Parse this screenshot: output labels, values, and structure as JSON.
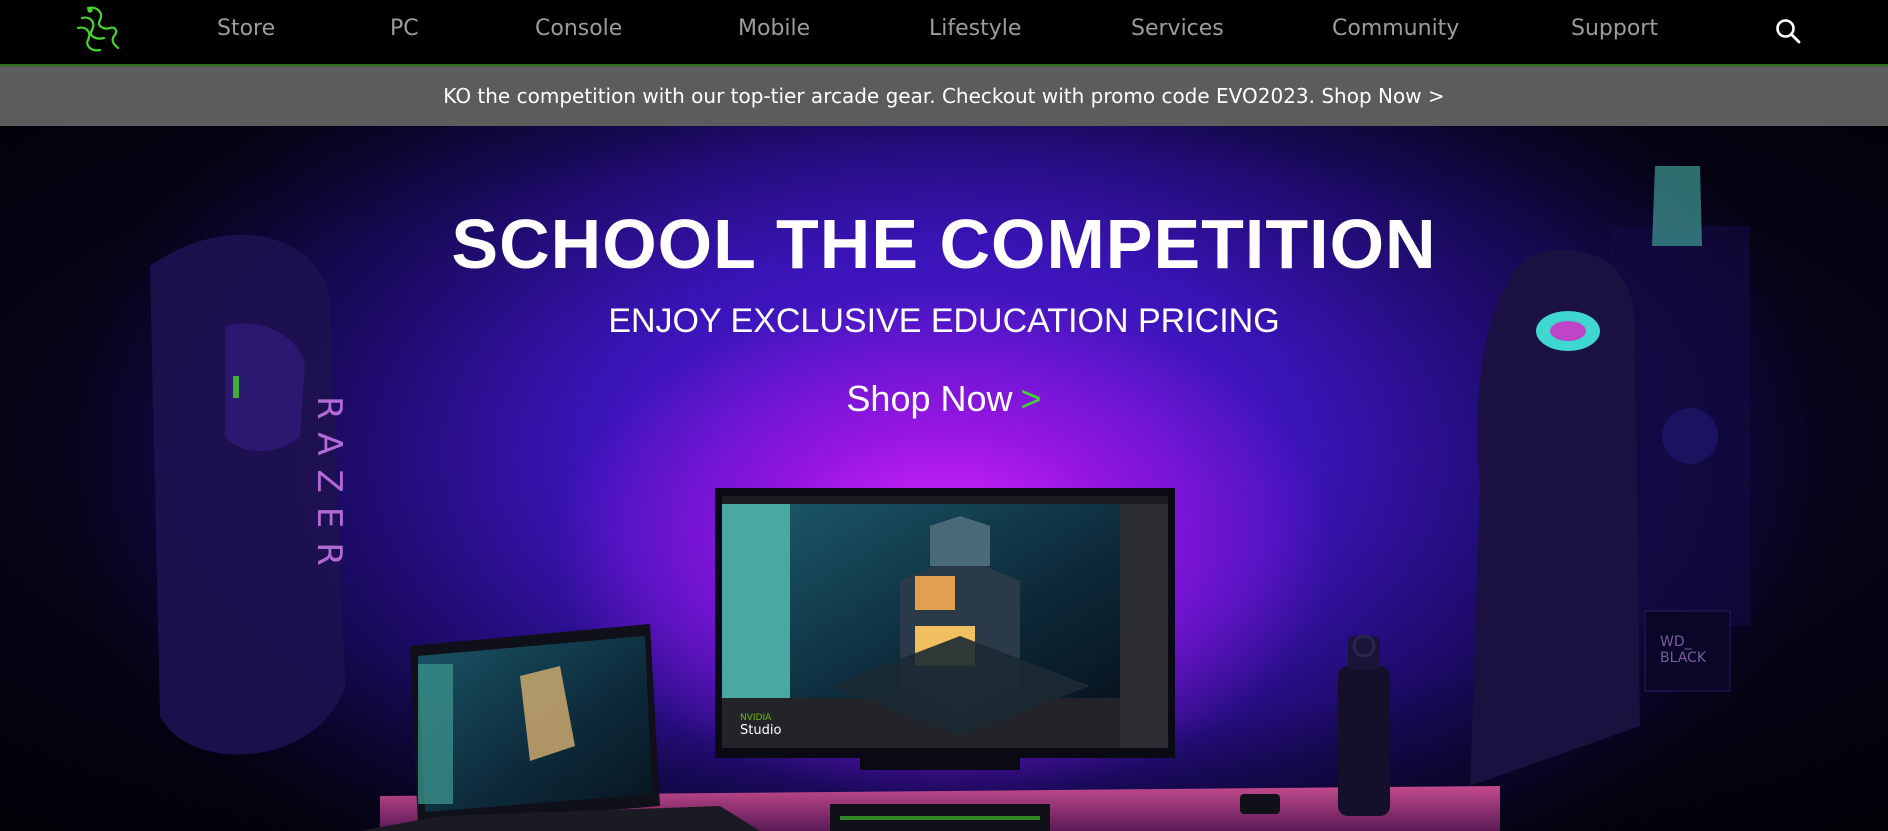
{
  "nav": {
    "logo_icon": "razer-snake-logo-icon",
    "items": [
      {
        "label": "Store"
      },
      {
        "label": "PC"
      },
      {
        "label": "Console"
      },
      {
        "label": "Mobile"
      },
      {
        "label": "Lifestyle"
      },
      {
        "label": "Services"
      },
      {
        "label": "Community"
      },
      {
        "label": "Support"
      }
    ],
    "search_icon": "search-icon"
  },
  "promo": {
    "text": "KO the competition with our top-tier arcade gear. Checkout with promo code EVO2023. Shop Now >"
  },
  "hero": {
    "title": "SCHOOL THE COMPETITION",
    "subtitle": "ENJOY EXCLUSIVE EDUCATION PRICING",
    "cta_label": "Shop Now",
    "cta_chevron": ">"
  },
  "colors": {
    "brand_green": "#44d62c",
    "nav_text": "#9c9c9c",
    "promo_bg": "#5c5c5c"
  }
}
